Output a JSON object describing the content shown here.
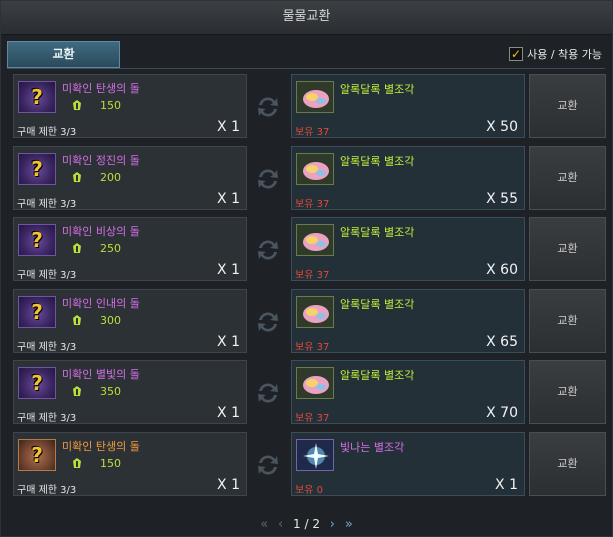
{
  "window": {
    "title": "물물교환"
  },
  "tab": {
    "label": "교환"
  },
  "filter": {
    "checked": true,
    "label": "사용 / 착용 가능"
  },
  "rows": [
    {
      "name": "미확인 탄생의 돌",
      "name_color": "purple",
      "cost": "150",
      "limit": "구매 제한 3/3",
      "lqty": "X 1",
      "reward": "알록달록 별조각",
      "reward_color": "green",
      "own": "보유 37",
      "rqty": "X 50",
      "button": "교환"
    },
    {
      "name": "미확인 정진의 돌",
      "name_color": "purple",
      "cost": "200",
      "limit": "구매 제한 3/3",
      "lqty": "X 1",
      "reward": "알록달록 별조각",
      "reward_color": "green",
      "own": "보유 37",
      "rqty": "X 55",
      "button": "교환"
    },
    {
      "name": "미확인 비상의 돌",
      "name_color": "purple",
      "cost": "250",
      "limit": "구매 제한 3/3",
      "lqty": "X 1",
      "reward": "알록달록 별조각",
      "reward_color": "green",
      "own": "보유 37",
      "rqty": "X 60",
      "button": "교환"
    },
    {
      "name": "미확인 인내의 돌",
      "name_color": "purple",
      "cost": "300",
      "limit": "구매 제한 3/3",
      "lqty": "X 1",
      "reward": "알록달록 별조각",
      "reward_color": "green",
      "own": "보유 37",
      "rqty": "X 65",
      "button": "교환"
    },
    {
      "name": "미확인 별빛의 돌",
      "name_color": "purple",
      "cost": "350",
      "limit": "구매 제한 3/3",
      "lqty": "X 1",
      "reward": "알록달록 별조각",
      "reward_color": "green",
      "own": "보유 37",
      "rqty": "X 70",
      "button": "교환"
    },
    {
      "name": "미확인 탄생의 돌",
      "name_color": "orange",
      "cost": "150",
      "limit": "구매 제한 3/3",
      "lqty": "X 1",
      "reward": "빛나는 별조각",
      "reward_color": "purple",
      "own": "보유 0",
      "rqty": "X 1",
      "button": "교환"
    }
  ],
  "pager": {
    "text": "1 / 2"
  },
  "colors": {
    "accent": "#4f7f99",
    "name_purple": "#d56ee8",
    "name_orange": "#f39b3c",
    "cost_green": "#b7e03a",
    "owned_red": "#e04a3a"
  }
}
